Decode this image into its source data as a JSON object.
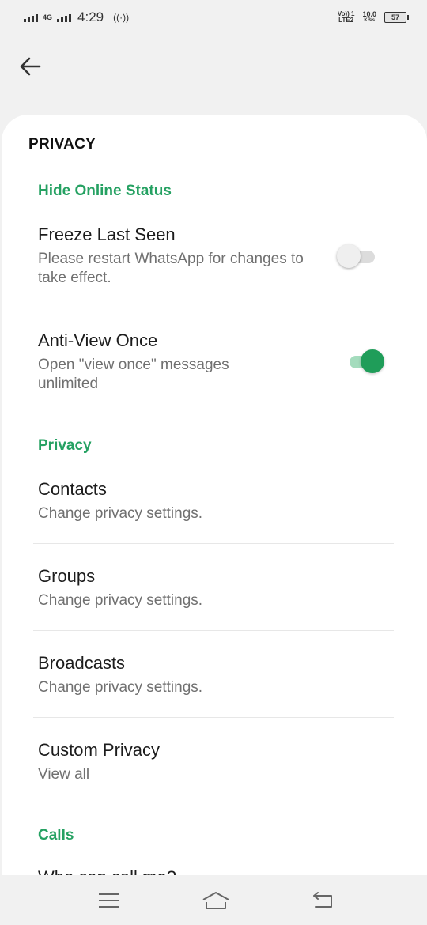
{
  "status_bar": {
    "network": "4G",
    "time": "4:29",
    "volte": "Vo)) 1",
    "lte": "LTE2",
    "speed_value": "10.0",
    "speed_unit": "KB/s",
    "battery": "57"
  },
  "card": {
    "section_title": "PRIVACY",
    "categories": {
      "hide_online": "Hide Online Status",
      "privacy": "Privacy",
      "calls": "Calls"
    },
    "items": [
      {
        "title": "Freeze Last Seen",
        "subtitle": "Please restart WhatsApp for changes to take effect.",
        "toggle": false
      },
      {
        "title": "Anti-View Once",
        "subtitle": "Open \"view once\" messages unlimited",
        "toggle": true
      },
      {
        "title": "Contacts",
        "subtitle": "Change privacy settings."
      },
      {
        "title": "Groups",
        "subtitle": "Change privacy settings."
      },
      {
        "title": "Broadcasts",
        "subtitle": "Change privacy settings."
      },
      {
        "title": "Custom Privacy",
        "subtitle": "View all"
      }
    ],
    "cut_off_text": "Who can call me?"
  },
  "colors": {
    "accent": "#25a162",
    "toggle_on": "#1f9d59",
    "background": "#f1f1f1"
  },
  "icons": {
    "back": "arrow-left-icon",
    "nav_menu": "menu-icon",
    "nav_home": "home-icon",
    "nav_back": "return-icon"
  }
}
